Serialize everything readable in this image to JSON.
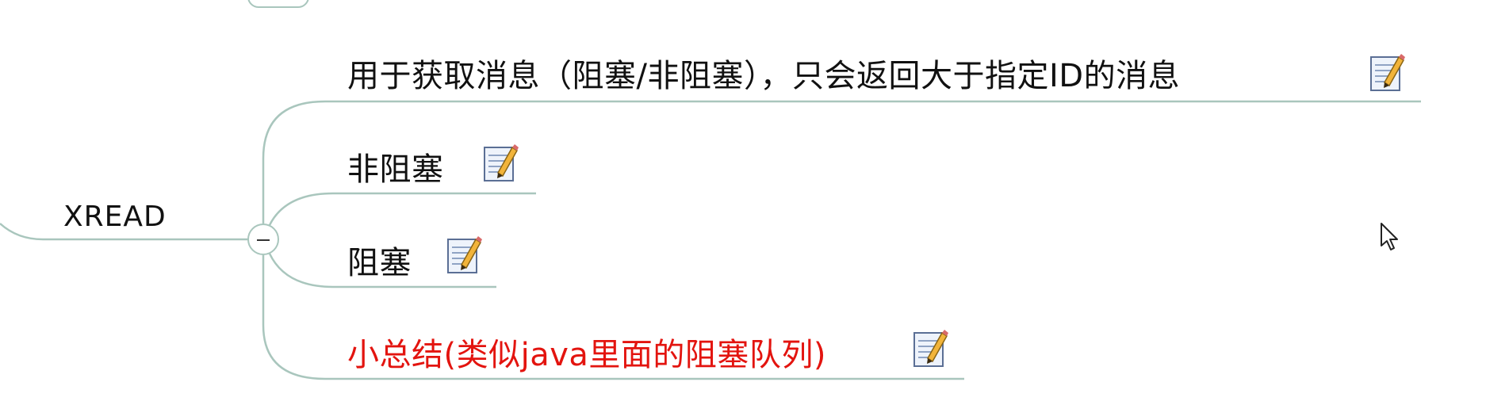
{
  "mindmap": {
    "root": {
      "label": "XREAD"
    },
    "children": [
      {
        "label": "用于获取消息（阻塞/非阻塞），只会返回大于指定ID的消息",
        "has_note": true,
        "accent": false
      },
      {
        "label": "非阻塞",
        "has_note": true,
        "accent": false
      },
      {
        "label": "阻塞",
        "has_note": true,
        "accent": false
      },
      {
        "label": "小总结(类似java里面的阻塞队列)",
        "has_note": true,
        "accent": true
      }
    ],
    "collapse_control": {
      "state": "expanded",
      "icon": "minus-icon"
    },
    "note_icon": "note-pencil-icon"
  },
  "colors": {
    "connector": "#a9c6bd",
    "text": "#111111",
    "accent": "#e3140f",
    "background": "#ffffff"
  },
  "cursor": {
    "icon": "mouse-pointer-icon"
  }
}
